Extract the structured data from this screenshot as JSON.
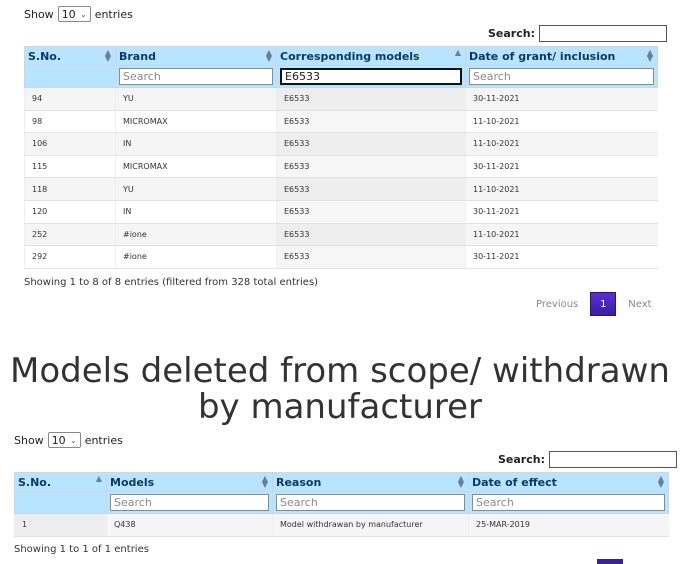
{
  "table1": {
    "show_label": "Show",
    "show_value": "10",
    "entries_label": "entries",
    "search_label": "Search:",
    "search_value": "",
    "columns": [
      "S.No.",
      "Brand",
      "Corresponding models",
      "Date of grant/ inclusion"
    ],
    "filters": [
      {
        "placeholder": "",
        "value": ""
      },
      {
        "placeholder": "Search",
        "value": ""
      },
      {
        "placeholder": "",
        "value": "E6533"
      },
      {
        "placeholder": "Search",
        "value": ""
      }
    ],
    "rows": [
      [
        "94",
        "YU",
        "E6533",
        "30-11-2021"
      ],
      [
        "98",
        "MICROMAX",
        "E6533",
        "11-10-2021"
      ],
      [
        "106",
        "IN",
        "E6533",
        "11-10-2021"
      ],
      [
        "115",
        "MICROMAX",
        "E6533",
        "30-11-2021"
      ],
      [
        "118",
        "YU",
        "E6533",
        "11-10-2021"
      ],
      [
        "120",
        "IN",
        "E6533",
        "30-11-2021"
      ],
      [
        "252",
        "#ione",
        "E6533",
        "11-10-2021"
      ],
      [
        "292",
        "#ione",
        "E6533",
        "30-11-2021"
      ]
    ],
    "info": "Showing 1 to 8 of 8 entries (filtered from 328 total entries)",
    "pager": {
      "previous": "Previous",
      "page": "1",
      "next": "Next"
    }
  },
  "section_title": "Models deleted from scope/ withdrawn by manufacturer",
  "table2": {
    "show_label": "Show",
    "show_value": "10",
    "entries_label": "entries",
    "search_label": "Search:",
    "search_value": "",
    "columns": [
      "S.No.",
      "Models",
      "Reason",
      "Date of effect"
    ],
    "filters": [
      {
        "placeholder": "",
        "value": ""
      },
      {
        "placeholder": "Search",
        "value": ""
      },
      {
        "placeholder": "Search",
        "value": ""
      },
      {
        "placeholder": "Search",
        "value": ""
      }
    ],
    "rows": [
      [
        "1",
        "Q438",
        "Model withdrawan by manufacturer",
        "25-MAR-2019"
      ]
    ],
    "info": "Showing 1 to 1 of 1 entries"
  },
  "colors": {
    "header_bg": "#b8e4ff",
    "header_text": "#0b3a64",
    "page_button": "#4a25c0"
  }
}
